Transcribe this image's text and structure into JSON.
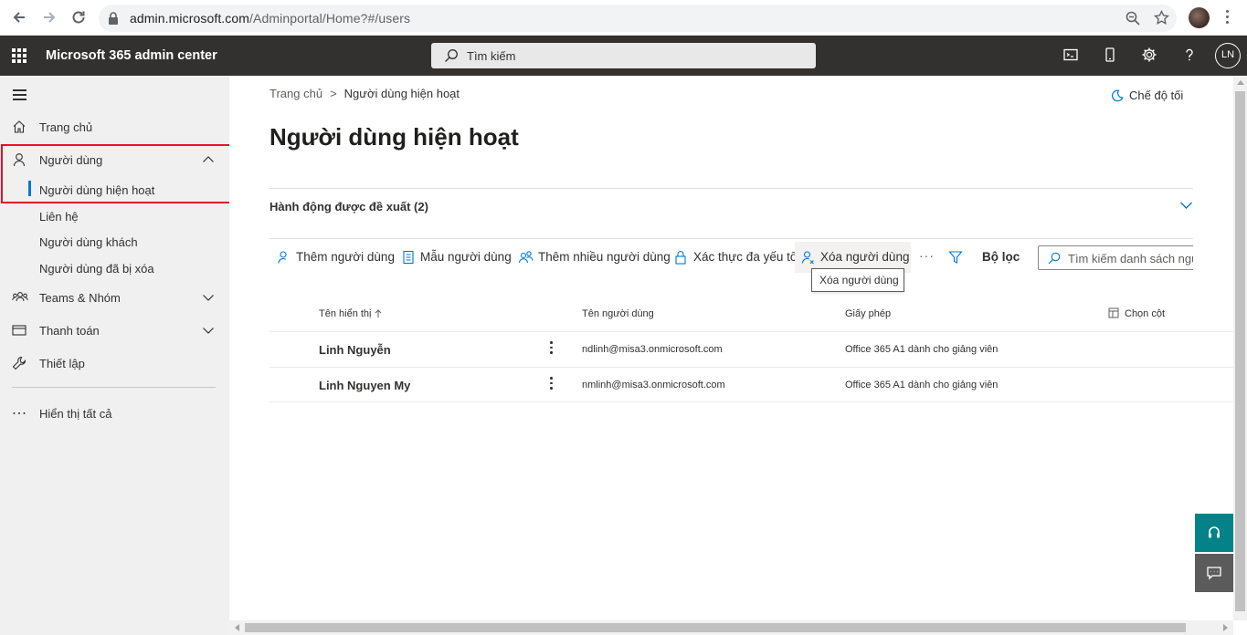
{
  "browser": {
    "url_domain": "admin.microsoft.com",
    "url_path": "/Adminportal/Home?#/users"
  },
  "header": {
    "app_title": "Microsoft 365 admin center",
    "search_placeholder": "Tìm kiếm",
    "avatar_initials": "LN"
  },
  "sidebar": {
    "home": "Trang chủ",
    "users": "Người dùng",
    "users_sub": [
      "Người dùng hiện hoạt",
      "Liên hệ",
      "Người dùng khách",
      "Người dùng đã bị xóa"
    ],
    "teams": "Teams & Nhóm",
    "billing": "Thanh toán",
    "setup": "Thiết lập",
    "show_all": "Hiển thị tất cả"
  },
  "main": {
    "breadcrumb_home": "Trang chủ",
    "breadcrumb_current": "Người dùng hiện hoạt",
    "dark_mode": "Chế độ tối",
    "title": "Người dùng hiện hoạt",
    "recommended": "Hành động được đề xuất (2)",
    "commands": {
      "add_user": "Thêm người dùng",
      "user_templates": "Mẫu người dùng",
      "add_multiple": "Thêm nhiều người dùng",
      "mfa": "Xác thực đa yếu tố",
      "delete_user": "Xóa người dùng",
      "more": "···",
      "filter": "Bộ lọc",
      "search_placeholder": "Tìm kiếm danh sách người dùng"
    },
    "tooltip": "Xóa người dùng",
    "columns": {
      "display_name": "Tên hiển thị",
      "username": "Tên người dùng",
      "license": "Giấy phép",
      "choose_columns": "Chọn cột"
    },
    "rows": [
      {
        "name": "Linh Nguyễn",
        "username": "ndlinh@misa3.onmicrosoft.com",
        "license": "Office 365 A1 dành cho giảng viên"
      },
      {
        "name": "Linh Nguyen My",
        "username": "nmlinh@misa3.onmicrosoft.com",
        "license": "Office 365 A1 dành cho giảng viên"
      }
    ]
  },
  "colors": {
    "suitebar": "#323130",
    "accent": "#0078d4",
    "highlight_box": "#e81123",
    "help_teal": "#038387"
  }
}
